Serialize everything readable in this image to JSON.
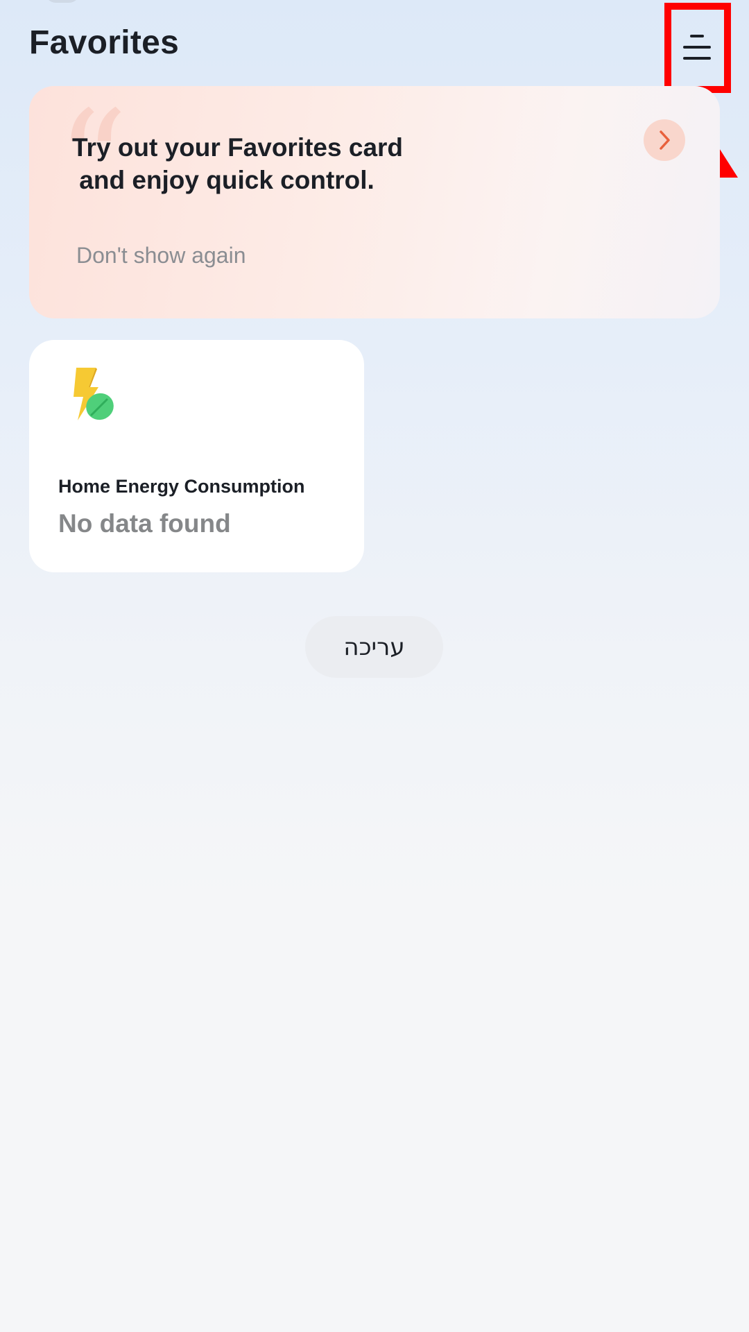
{
  "header": {
    "title": "Favorites",
    "menu_icon": "hamburger-menu-icon"
  },
  "promo_card": {
    "text": "Try out your Favorites card\n and enjoy quick control.",
    "dismiss_label": "Don't show again",
    "arrow_icon": "chevron-right-icon",
    "quote_icon": "quote-icon"
  },
  "energy_card": {
    "title": "Home Energy Consumption",
    "status": "No data found",
    "icon": "lightning-leaf-icon"
  },
  "edit_button": {
    "label": "עריכה"
  },
  "annotation": {
    "color": "#ff0000",
    "target": "hamburger-menu-icon"
  },
  "colors": {
    "accent_orange": "#e8603c",
    "promo_bg": "#fde2db",
    "text_primary": "#1b1f26",
    "text_muted": "#858789"
  }
}
